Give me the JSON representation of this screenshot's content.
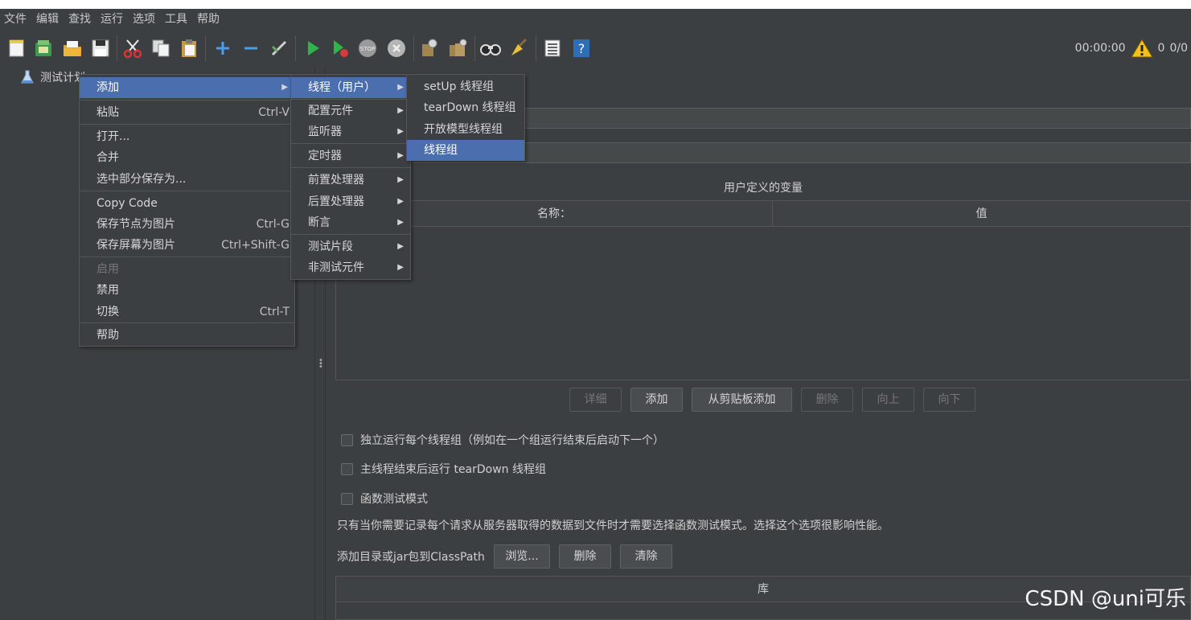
{
  "menubar": [
    "文件",
    "编辑",
    "查找",
    "运行",
    "选项",
    "工具",
    "帮助"
  ],
  "toolbar": {
    "icons": [
      "new-icon",
      "templates-icon",
      "open-icon",
      "save-icon",
      "cut-icon",
      "copy-icon",
      "paste-icon",
      "expand-icon",
      "collapse-icon",
      "toggle-icon",
      "start-icon",
      "start-no-pause-icon",
      "stop-icon",
      "shutdown-icon",
      "clear-icon",
      "clear-all-icon",
      "search-icon",
      "reset-search-icon",
      "function-helper-icon",
      "help-icon"
    ],
    "timer": "00:00:00",
    "warnings": "0",
    "threads": "0/0"
  },
  "tree": {
    "root_label": "测试计划"
  },
  "context_menu": {
    "items": [
      {
        "label": "添加",
        "accel": "",
        "submenu": true
      },
      {
        "label": "粘贴",
        "accel": "Ctrl-V"
      },
      {
        "label": "打开...",
        "accel": ""
      },
      {
        "label": "合并",
        "accel": ""
      },
      {
        "label": "选中部分保存为...",
        "accel": ""
      },
      {
        "label": "Copy Code",
        "accel": ""
      },
      {
        "label": "保存节点为图片",
        "accel": "Ctrl-G"
      },
      {
        "label": "保存屏幕为图片",
        "accel": "Ctrl+Shift-G"
      },
      {
        "label": "启用",
        "accel": ""
      },
      {
        "label": "禁用",
        "accel": ""
      },
      {
        "label": "切换",
        "accel": "Ctrl-T"
      },
      {
        "label": "帮助",
        "accel": ""
      }
    ]
  },
  "add_submenu": {
    "items": [
      "线程（用户）",
      "配置元件",
      "监听器",
      "定时器",
      "前置处理器",
      "后置处理器",
      "断言",
      "测试片段",
      "非测试元件"
    ]
  },
  "thread_submenu": {
    "items": [
      "setUp 线程组",
      "tearDown 线程组",
      "开放模型线程组",
      "线程组"
    ]
  },
  "main": {
    "variables_title": "用户定义的变量",
    "col_name": "名称：",
    "col_value": "值",
    "buttons": {
      "detail": "详细",
      "add": "添加",
      "add_clipboard": "从剪贴板添加",
      "delete": "删除",
      "up": "向上",
      "down": "向下"
    },
    "checkbox_serial": "独立运行每个线程组（例如在一个组运行结束后启动下一个）",
    "checkbox_teardown": "主线程结束后运行 tearDown 线程组",
    "checkbox_functional": "函数测试模式",
    "functional_note": "只有当你需要记录每个请求从服务器取得的数据到文件时才需要选择函数测试模式。选择这个选项很影响性能。",
    "classpath_label": "添加目录或jar包到ClassPath",
    "classpath_buttons": {
      "browse": "浏览...",
      "delete": "删除",
      "clear": "清除"
    },
    "library_header": "库"
  },
  "watermark": "CSDN @uni可乐"
}
